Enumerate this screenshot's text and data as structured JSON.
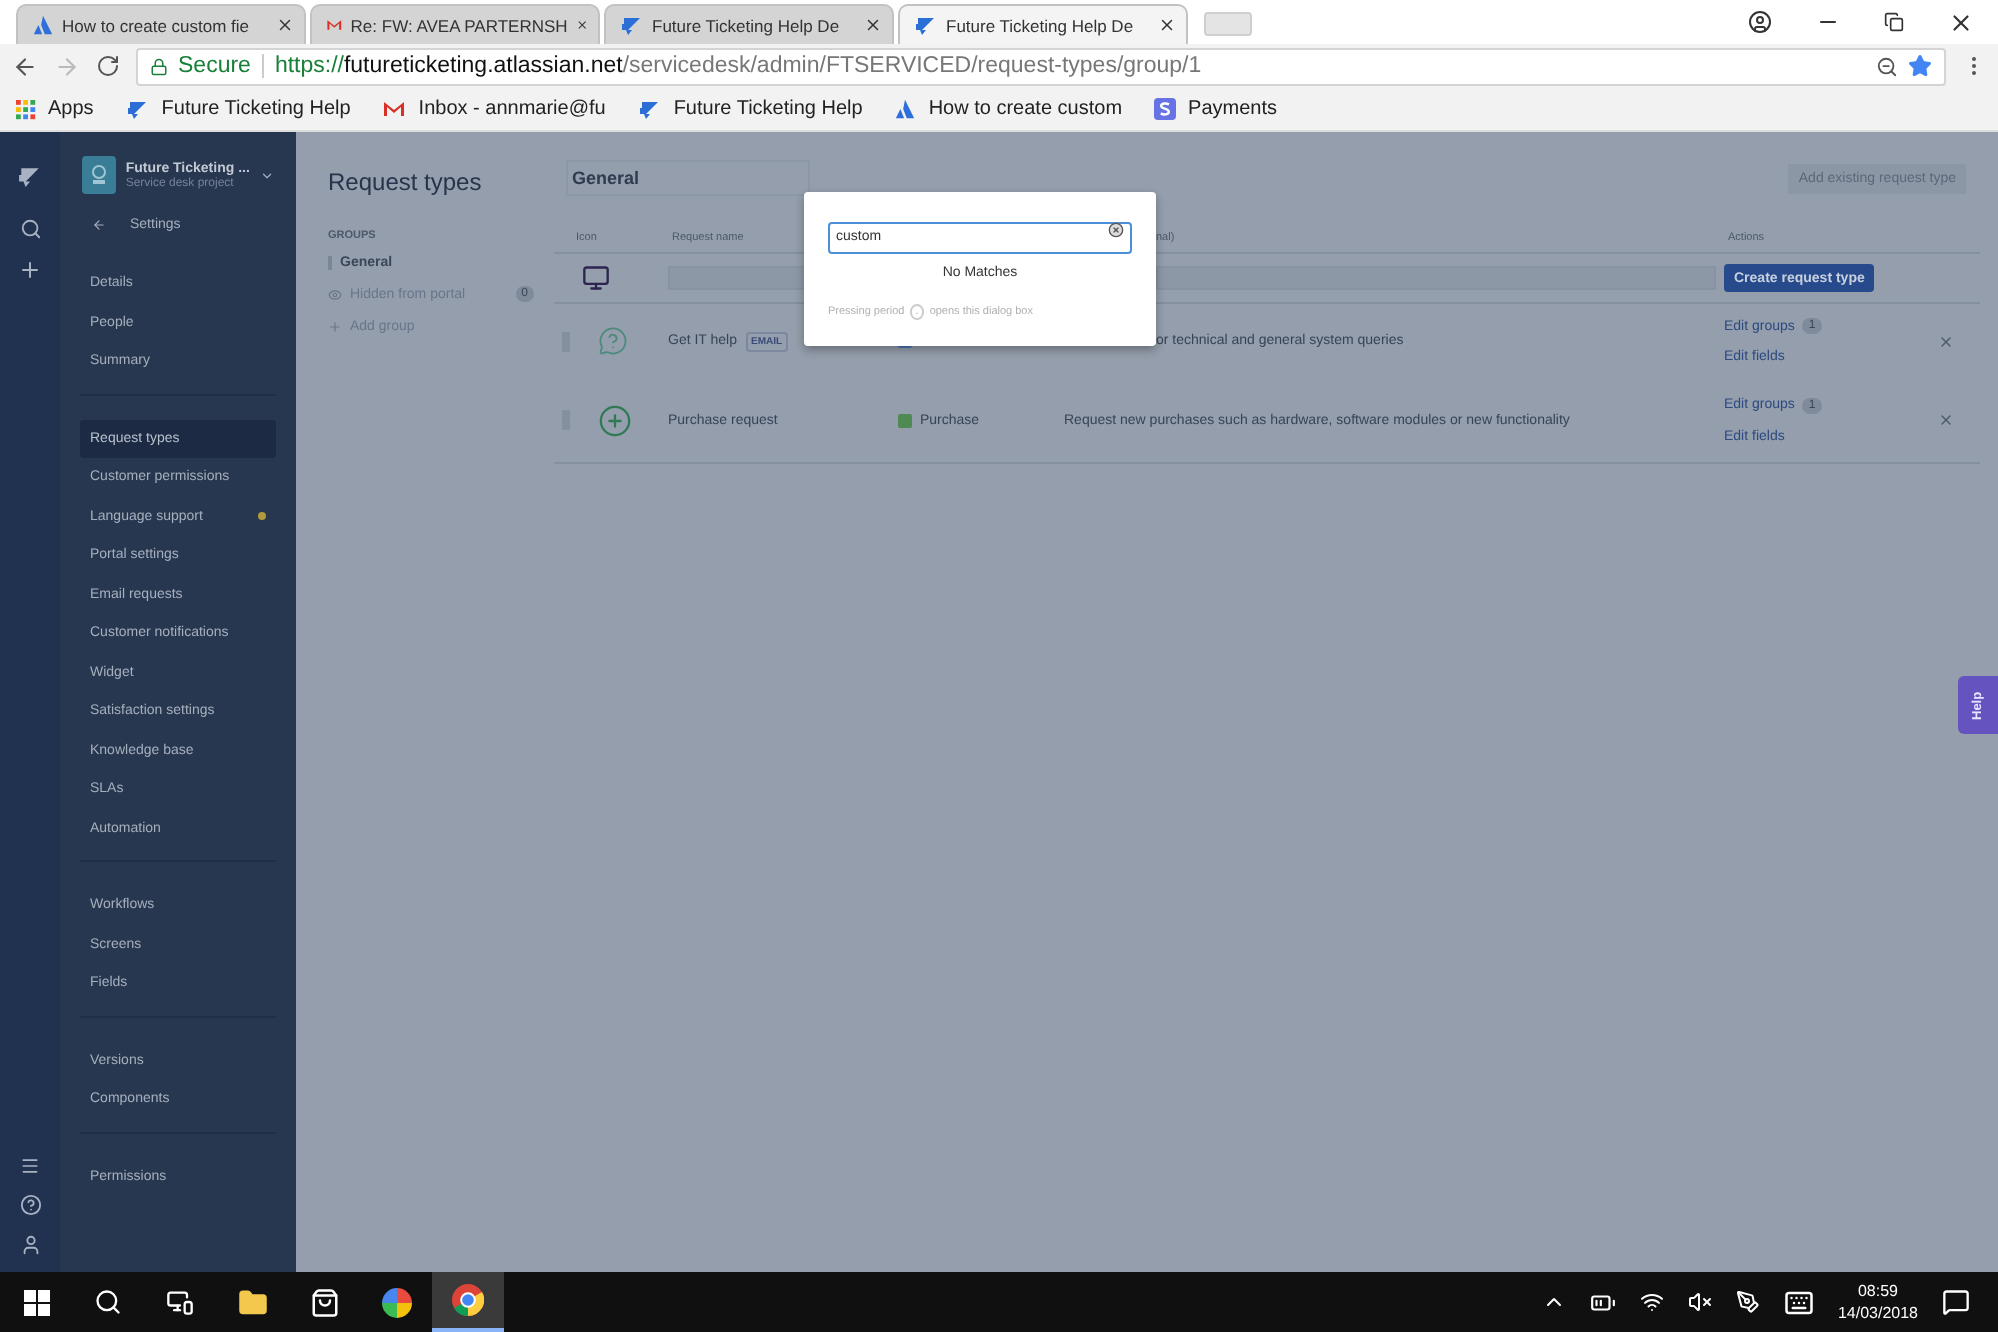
{
  "browser": {
    "tabs": [
      {
        "title": "How to create custom fie",
        "selected": false
      },
      {
        "title": "Re: FW: AVEA PARTERNSH",
        "selected": false
      },
      {
        "title": "Future Ticketing Help De",
        "selected": false
      },
      {
        "title": "Future Ticketing Help De",
        "selected": true
      }
    ],
    "address": {
      "secure_label": "Secure",
      "scheme": "https://",
      "host": "futureticketing.atlassian.net",
      "path": "/servicedesk/admin/FTSERVICED/request-types/group/1"
    },
    "bookmarks": [
      {
        "label": "Apps"
      },
      {
        "label": "Future Ticketing Help"
      },
      {
        "label": "Inbox - annmarie@fu"
      },
      {
        "label": "Future Ticketing Help"
      },
      {
        "label": "How to create custom"
      },
      {
        "label": "Payments"
      }
    ]
  },
  "sidebar": {
    "project_name": "Future Ticketing ...",
    "project_type": "Service desk project",
    "back_label": "Settings",
    "sections": [
      [
        {
          "label": "Details",
          "selected": false,
          "flagged": false
        },
        {
          "label": "People",
          "selected": false,
          "flagged": false
        },
        {
          "label": "Summary",
          "selected": false,
          "flagged": false
        }
      ],
      [
        {
          "label": "Request types",
          "selected": true,
          "flagged": false
        },
        {
          "label": "Customer permissions",
          "selected": false,
          "flagged": false
        },
        {
          "label": "Language support",
          "selected": false,
          "flagged": true
        },
        {
          "label": "Portal settings",
          "selected": false,
          "flagged": false
        },
        {
          "label": "Email requests",
          "selected": false,
          "flagged": false
        },
        {
          "label": "Customer notifications",
          "selected": false,
          "flagged": false
        },
        {
          "label": "Widget",
          "selected": false,
          "flagged": false
        },
        {
          "label": "Satisfaction settings",
          "selected": false,
          "flagged": false
        },
        {
          "label": "Knowledge base",
          "selected": false,
          "flagged": false
        },
        {
          "label": "SLAs",
          "selected": false,
          "flagged": false
        },
        {
          "label": "Automation",
          "selected": false,
          "flagged": false
        }
      ],
      [
        {
          "label": "Workflows",
          "selected": false,
          "flagged": false
        },
        {
          "label": "Screens",
          "selected": false,
          "flagged": false
        },
        {
          "label": "Fields",
          "selected": false,
          "flagged": false
        }
      ],
      [
        {
          "label": "Versions",
          "selected": false,
          "flagged": false
        },
        {
          "label": "Components",
          "selected": false,
          "flagged": false
        }
      ],
      [
        {
          "label": "Permissions",
          "selected": false,
          "flagged": false
        }
      ]
    ]
  },
  "page": {
    "title": "Request types",
    "groups_heading": "GROUPS",
    "groups": [
      {
        "label": "General",
        "kind": "group",
        "selected": true
      },
      {
        "label": "Hidden from portal",
        "kind": "hidden",
        "count": "0",
        "selected": false
      }
    ],
    "add_group": "Add group"
  },
  "table": {
    "group_name": "General",
    "add_existing": "Add existing request type",
    "columns": [
      {
        "label": "Icon"
      },
      {
        "label": "Request name"
      },
      {
        "label": "nal)"
      },
      {
        "label": "Actions"
      }
    ],
    "create_button": "Create request type",
    "rows": [
      {
        "name": "Get IT help",
        "badge": "EMAIL",
        "description": "or technical and general system queries",
        "edit_groups": "Edit groups",
        "group_count": "1",
        "edit_fields": "Edit fields"
      },
      {
        "name": "Purchase request",
        "group": "Purchase",
        "description": "Request new purchases such as hardware, software modules or new functionality",
        "edit_groups": "Edit groups",
        "group_count": "1",
        "edit_fields": "Edit fields"
      }
    ]
  },
  "search_dialog": {
    "value": "custom",
    "message": "No Matches",
    "hint_before": "Pressing period",
    "hint_key": ".",
    "hint_after": "opens this dialog box"
  },
  "help_tab": "Help",
  "taskbar": {
    "time": "08:59",
    "date": "14/03/2018"
  }
}
